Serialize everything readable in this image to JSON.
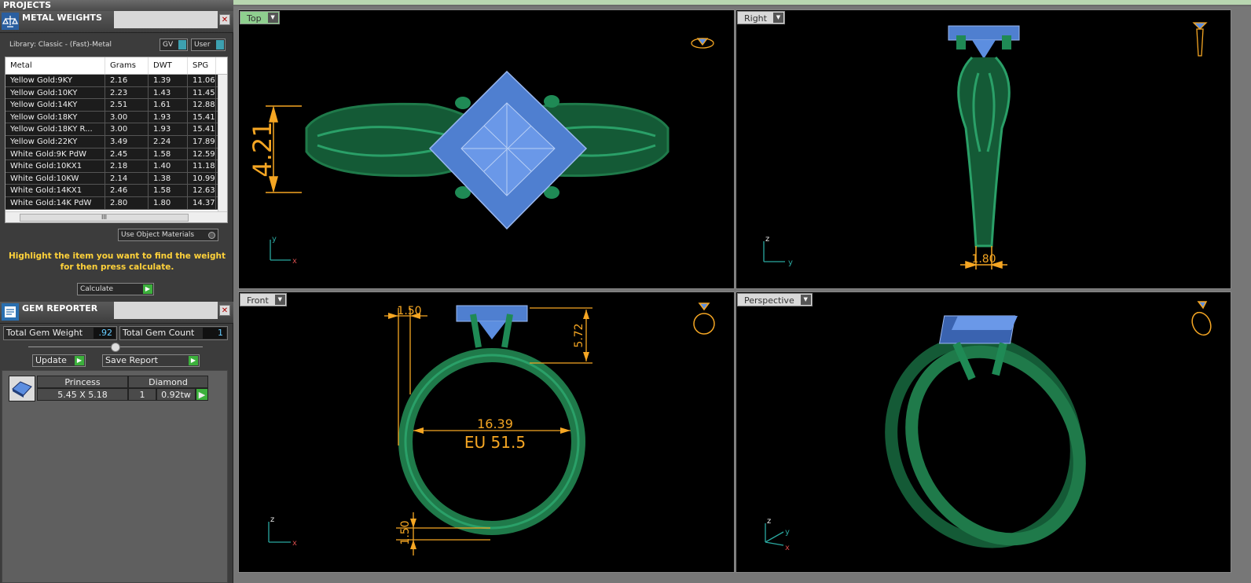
{
  "projects_title": "PROJECTS",
  "metal_weights": {
    "title": "METAL WEIGHTS",
    "library_label": "Library: Classic - (Fast)-Metal",
    "gv_label": "GV",
    "user_label": "User",
    "columns": [
      "Metal",
      "Grams",
      "DWT",
      "SPG"
    ],
    "rows": [
      [
        "Yellow Gold:9KY",
        "2.16",
        "1.39",
        "11.06"
      ],
      [
        "Yellow Gold:10KY",
        "2.23",
        "1.43",
        "11.45"
      ],
      [
        "Yellow Gold:14KY",
        "2.51",
        "1.61",
        "12.88"
      ],
      [
        "Yellow Gold:18KY",
        "3.00",
        "1.93",
        "15.41"
      ],
      [
        "Yellow Gold:18KY R...",
        "3.00",
        "1.93",
        "15.41"
      ],
      [
        "Yellow Gold:22KY",
        "3.49",
        "2.24",
        "17.89"
      ],
      [
        "White Gold:9K PdW",
        "2.45",
        "1.58",
        "12.59"
      ],
      [
        "White Gold:10KX1",
        "2.18",
        "1.40",
        "11.18"
      ],
      [
        "White Gold:10KW",
        "2.14",
        "1.38",
        "10.99"
      ],
      [
        "White Gold:14KX1",
        "2.46",
        "1.58",
        "12.63"
      ],
      [
        "White Gold:14K PdW",
        "2.80",
        "1.80",
        "14.37"
      ]
    ],
    "scroll_thumb": "III",
    "use_object_materials": "Use Object Materials",
    "hint": "Highlight the item you want to find the weight for then press calculate.",
    "calculate_label": "Calculate"
  },
  "gem_reporter": {
    "title": "GEM REPORTER",
    "total_weight_label": "Total Gem Weight",
    "total_weight_value": ".92",
    "total_count_label": "Total Gem Count",
    "total_count_value": "1",
    "update_label": "Update",
    "save_report_label": "Save Report",
    "gem": {
      "shape": "Princess",
      "type": "Diamond",
      "size": "5.45 X 5.18",
      "count": "1",
      "weight": "0.92tw"
    }
  },
  "viewports": {
    "top": {
      "label": "Top",
      "dimension": "4.21"
    },
    "right": {
      "label": "Right",
      "dimension": "1.80"
    },
    "front": {
      "label": "Front",
      "dim_top_left": "1.50",
      "dim_right": "5.72",
      "dim_inner": "16.39",
      "ring_size": "EU 51.5",
      "dim_bottom": "1.50"
    },
    "perspective": {
      "label": "Perspective"
    }
  },
  "colors": {
    "metal": "#1f7a4a",
    "gem": "#5c8ee0",
    "dimension": "#f5a623",
    "active_view": "#8fcf8f"
  }
}
